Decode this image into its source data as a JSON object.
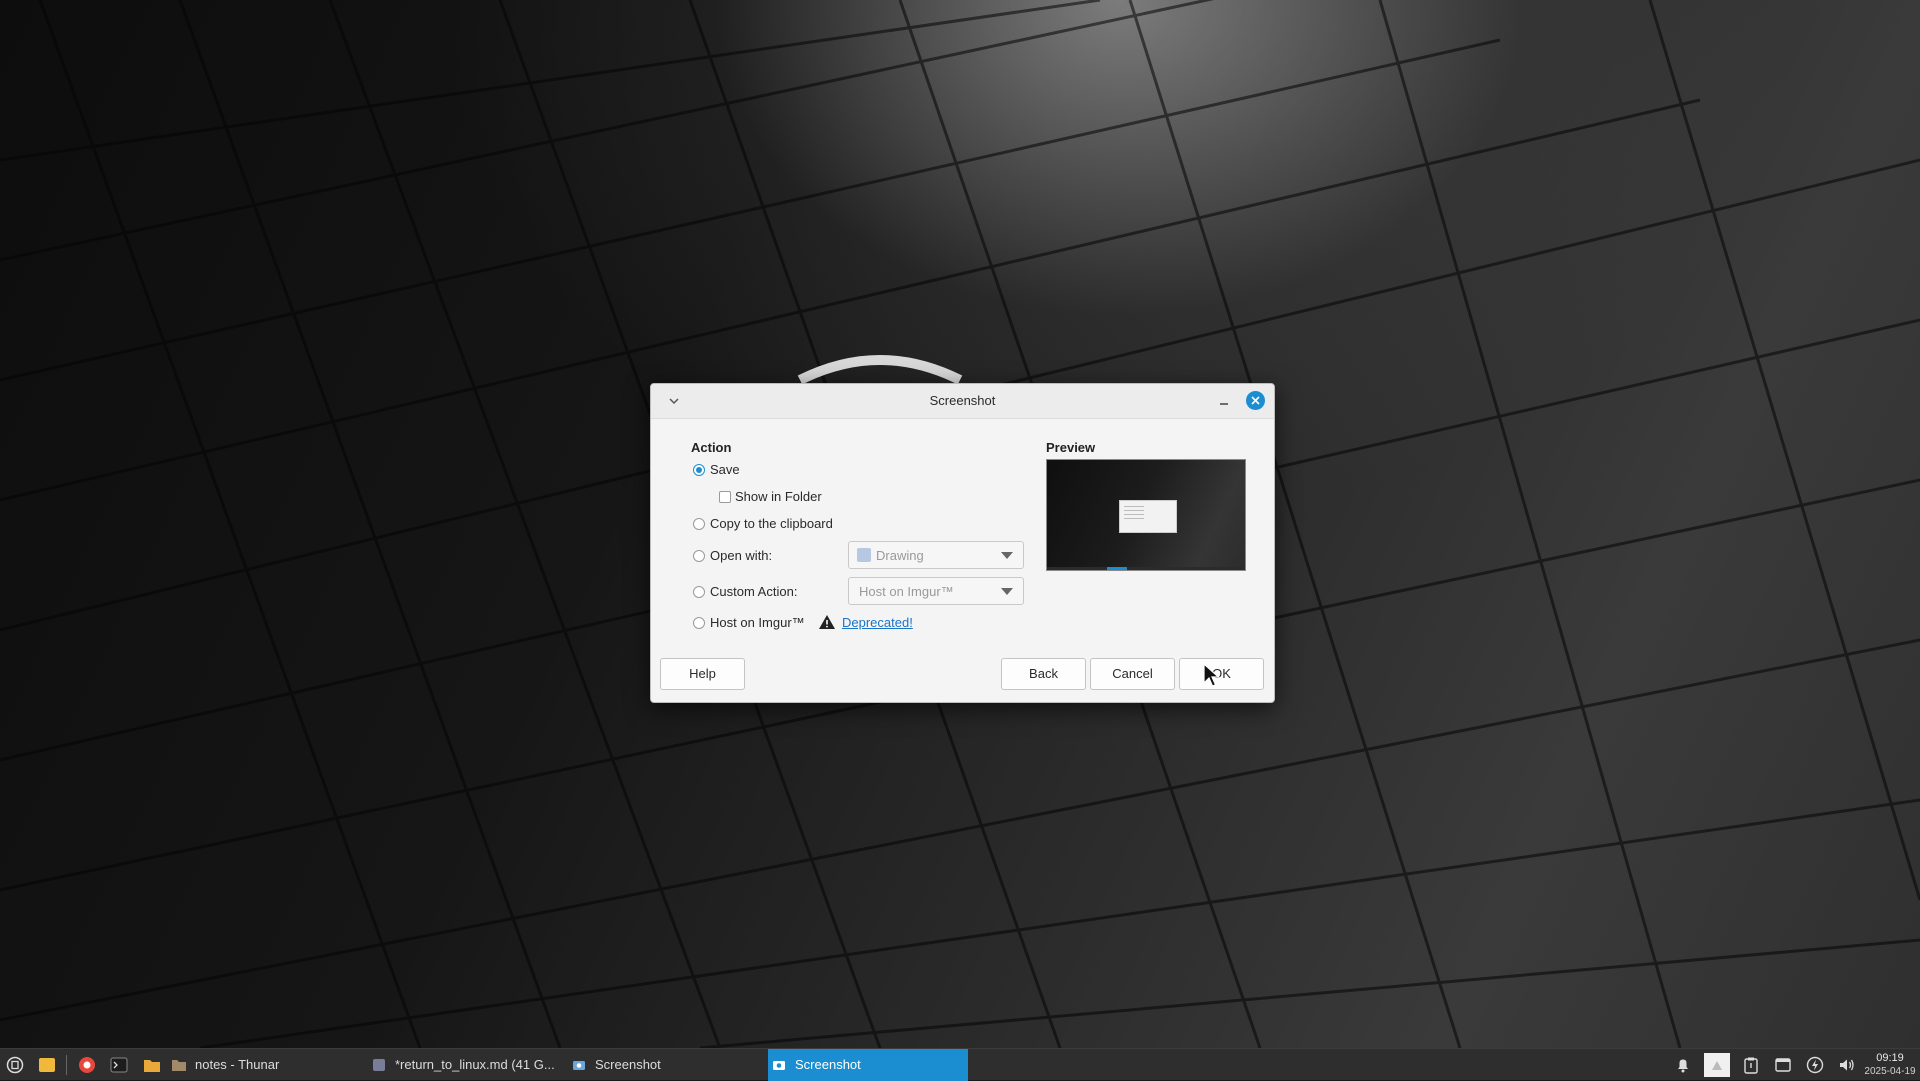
{
  "window": {
    "title": "Screenshot",
    "action_heading": "Action",
    "preview_heading": "Preview",
    "options": {
      "save": "Save",
      "show_in_folder": "Show in Folder",
      "copy_clipboard": "Copy to the clipboard",
      "open_with": "Open with:",
      "open_with_value": "Drawing",
      "custom_action": "Custom Action:",
      "custom_action_value": "Host on Imgur™",
      "host_imgur": "Host on Imgur™",
      "deprecated_link": "Deprecated!"
    },
    "selected_option": "save",
    "show_in_folder_checked": false,
    "buttons": {
      "help": "Help",
      "back": "Back",
      "cancel": "Cancel",
      "ok": "OK"
    }
  },
  "taskbar": {
    "tasks": [
      {
        "label": "notes - Thunar",
        "icon": "folder-icon"
      },
      {
        "label": "*return_to_linux.md (41 G...",
        "icon": "text-editor-icon"
      },
      {
        "label": "Screenshot",
        "icon": "screenshot-icon"
      },
      {
        "label": "Screenshot",
        "icon": "screenshot-icon",
        "active": true
      }
    ],
    "clock_time": "09:19",
    "clock_date": "2025-04-19"
  },
  "colors": {
    "accent": "#1a8ed1",
    "taskbar_bg": "#2e2e2e",
    "window_bg": "#f4f4f4"
  }
}
